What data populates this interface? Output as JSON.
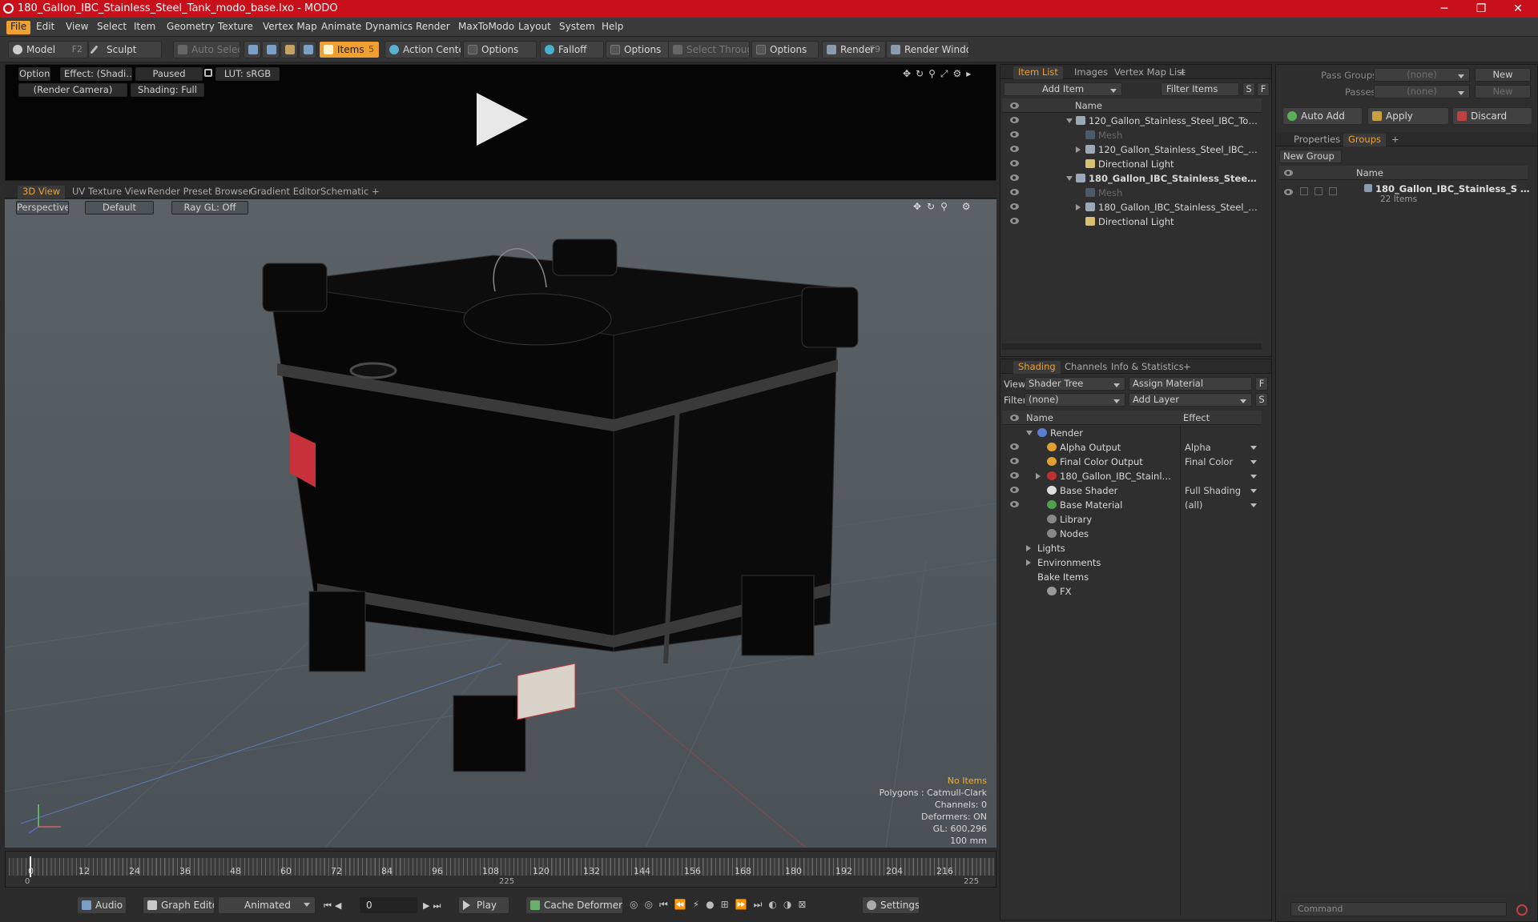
{
  "window": {
    "title": "180_Gallon_IBC_Stainless_Steel_Tank_modo_base.lxo - MODO",
    "minimize": "─",
    "restore": "❐",
    "close": "✕"
  },
  "menu": [
    "File",
    "Edit",
    "View",
    "Select",
    "Item",
    "Geometry",
    "Texture",
    "Vertex Map",
    "Animate",
    "Dynamics",
    "Render",
    "MaxToModo",
    "Layout",
    "System",
    "Help"
  ],
  "toolbar": {
    "model": "Model",
    "model_key": "F2",
    "sculpt": "Sculpt",
    "auto_select": "Auto Select",
    "items": "Items",
    "items_key": "5",
    "action_center": "Action Center",
    "options1": "Options",
    "falloff": "Falloff",
    "options2": "Options",
    "select_through": "Select Through",
    "options3": "Options",
    "render": "Render",
    "render_key": "F9",
    "render_window": "Render Window"
  },
  "preview": {
    "options": "Options",
    "effect": "Effect: (Shadi…",
    "paused": "Paused",
    "lut": "LUT: sRGB",
    "camera": "(Render Camera)",
    "shading": "Shading: Full"
  },
  "viewport_tabs": [
    "3D View",
    "UV Texture View",
    "Render Preset Browser",
    "Gradient Editor",
    "Schematic",
    "+"
  ],
  "viewport": {
    "perspective": "Perspective",
    "default": "Default",
    "raygl": "Ray GL: Off",
    "hud": {
      "no_items": "No Items",
      "polygons": "Polygons : Catmull-Clark",
      "channels": "Channels: 0",
      "deformers": "Deformers: ON",
      "gl": "GL: 600,296",
      "scale": "100 mm"
    }
  },
  "timeline": {
    "ticks": [
      "0",
      "12",
      "24",
      "36",
      "48",
      "60",
      "72",
      "84",
      "96",
      "108",
      "120",
      "132",
      "144",
      "156",
      "168",
      "180",
      "192",
      "204",
      "216"
    ],
    "range_start": "0",
    "range_mid": "225",
    "range_end": "225"
  },
  "bottombar": {
    "audio": "Audio",
    "graph_editor": "Graph Editor",
    "animated": "Animated",
    "frame": "0",
    "play": "Play",
    "cache_deformers": "Cache Deformers",
    "settings": "Settings"
  },
  "item_list": {
    "tabs": [
      "Item List",
      "Images",
      "Vertex Map List",
      "+"
    ],
    "add_item": "Add Item",
    "filter_items": "Filter Items",
    "s": "S",
    "f": "F",
    "col_name": "Name",
    "rows": [
      {
        "label": "120_Gallon_Stainless_Steel_IBC_Tote_T…",
        "bold": false,
        "dim": false,
        "indent": 0,
        "expander": "down"
      },
      {
        "label": "Mesh",
        "bold": false,
        "dim": true,
        "indent": 1,
        "expander": ""
      },
      {
        "label": "120_Gallon_Stainless_Steel_IBC_Tote…",
        "bold": false,
        "dim": false,
        "indent": 1,
        "expander": "right"
      },
      {
        "label": "Directional Light",
        "bold": false,
        "dim": false,
        "indent": 1,
        "expander": ""
      },
      {
        "label": "180_Gallon_IBC_Stainless_Steel_…",
        "bold": true,
        "dim": false,
        "indent": 0,
        "expander": "down"
      },
      {
        "label": "Mesh",
        "bold": false,
        "dim": true,
        "indent": 1,
        "expander": ""
      },
      {
        "label": "180_Gallon_IBC_Stainless_Steel_Tank",
        "bold": false,
        "dim": false,
        "indent": 1,
        "expander": "right"
      },
      {
        "label": "Directional Light",
        "bold": false,
        "dim": false,
        "indent": 1,
        "expander": ""
      }
    ]
  },
  "shading": {
    "tabs": [
      "Shading",
      "Channels",
      "Info & Statistics",
      "+"
    ],
    "view_label": "View",
    "view_value": "Shader Tree",
    "assign_material": "Assign Material",
    "filter_label": "Filter",
    "filter_value": "(none)",
    "add_layer": "Add Layer",
    "f": "F",
    "s": "S",
    "col_name": "Name",
    "col_effect": "Effect",
    "rows": [
      {
        "label": "Render",
        "effect": "",
        "icon_color": "#5a7fd0",
        "indent": 0,
        "expander": "down",
        "eye": false
      },
      {
        "label": "Alpha Output",
        "effect": "Alpha",
        "icon_color": "#e0a030",
        "indent": 1,
        "expander": "",
        "eye": true
      },
      {
        "label": "Final Color Output",
        "effect": "Final Color",
        "icon_color": "#e0a030",
        "indent": 1,
        "expander": "",
        "eye": true
      },
      {
        "label": "180_Gallon_IBC_Stainless …",
        "effect": "",
        "icon_color": "#c03030",
        "indent": 1,
        "expander": "right",
        "eye": true
      },
      {
        "label": "Base Shader",
        "effect": "Full Shading",
        "icon_color": "#dddddd",
        "indent": 1,
        "expander": "",
        "eye": true
      },
      {
        "label": "Base Material",
        "effect": "(all)",
        "icon_color": "#50a050",
        "indent": 1,
        "expander": "",
        "eye": true
      },
      {
        "label": "Library",
        "effect": "",
        "icon_color": "#888888",
        "indent": 1,
        "expander": "",
        "eye": false
      },
      {
        "label": "Nodes",
        "effect": "",
        "icon_color": "#888888",
        "indent": 1,
        "expander": "",
        "eye": false
      },
      {
        "label": "Lights",
        "effect": "",
        "icon_color": "",
        "indent": 0,
        "expander": "right",
        "eye": false
      },
      {
        "label": "Environments",
        "effect": "",
        "icon_color": "",
        "indent": 0,
        "expander": "right",
        "eye": false
      },
      {
        "label": "Bake Items",
        "effect": "",
        "icon_color": "",
        "indent": 0,
        "expander": "",
        "eye": false
      },
      {
        "label": "FX",
        "effect": "",
        "icon_color": "#999999",
        "indent": 1,
        "expander": "",
        "eye": false
      }
    ]
  },
  "right": {
    "pass_groups": "Pass Groups",
    "pass_groups_value": "(none)",
    "new": "New",
    "passes": "Passes",
    "passes_value": "(none)",
    "new2": "New",
    "auto_add": "Auto Add",
    "apply": "Apply",
    "discard": "Discard",
    "tabs": [
      "Properties",
      "Groups",
      "+"
    ],
    "new_group": "New Group",
    "col_name": "Name",
    "group_name": "180_Gallon_IBC_Stainless_S …",
    "group_count": "22 Items",
    "command_placeholder": "Command"
  }
}
